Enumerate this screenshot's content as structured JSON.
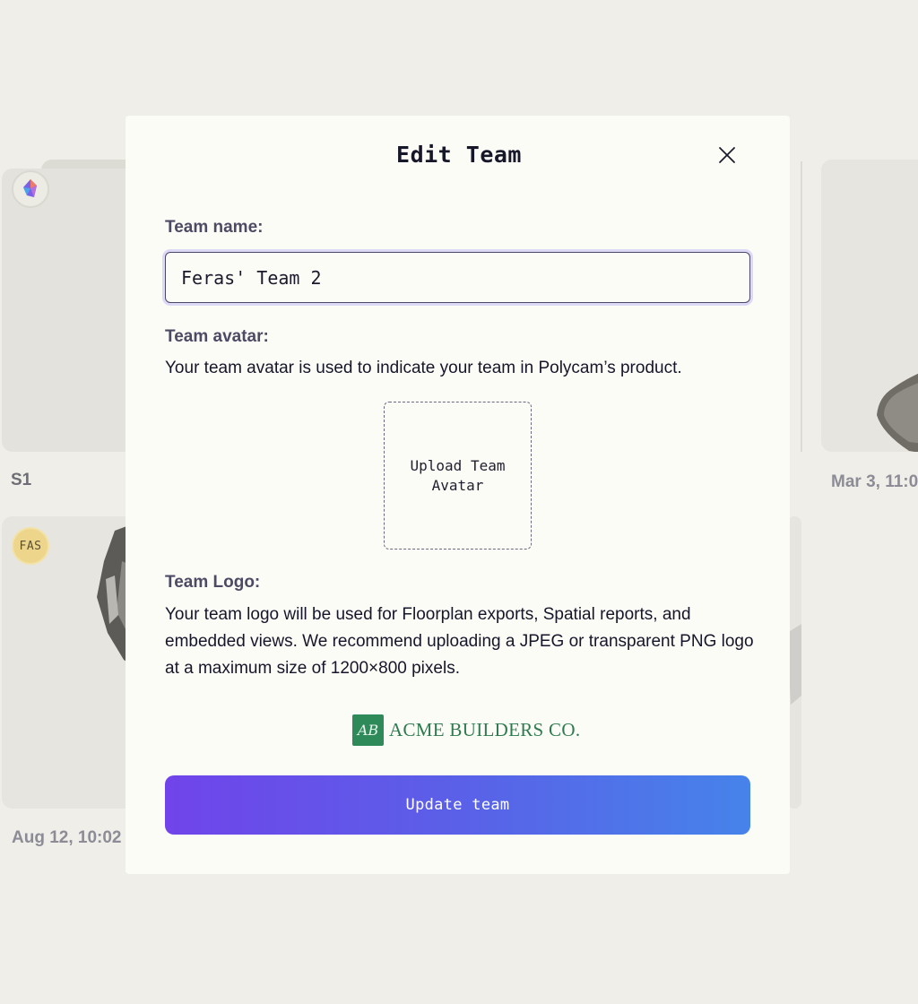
{
  "background": {
    "cards": [
      {
        "label": "S1",
        "avatar": "app-logo-icon"
      },
      {
        "label": "Mar 3, 11:0"
      },
      {
        "label": "Aug 12, 10:02",
        "avatar_initials": "FAS"
      }
    ]
  },
  "modal": {
    "title": "Edit Team",
    "close_icon": "close-icon",
    "team_name_label": "Team name:",
    "team_name_value": "Feras' Team 2",
    "team_avatar_label": "Team avatar:",
    "team_avatar_description": "Your team avatar is used to indicate your team in Polycam’s product.",
    "upload_avatar_label": "Upload Team Avatar",
    "team_logo_label": "Team Logo:",
    "team_logo_description": "Your team logo will be used for Floorplan exports, Spatial reports, and embedded views. We recommend uploading a JPEG or transparent PNG logo at a maximum size of 1200×800 pixels.",
    "logo": {
      "mark": "AB",
      "text": "ACME BUILDERS CO.",
      "color": "#2f8a5a"
    },
    "update_button_label": "Update team"
  },
  "colors": {
    "page_background": "#efeee8",
    "modal_background": "#fcfcf7",
    "button_gradient_start": "#7044ea",
    "button_gradient_end": "#4683ea",
    "label_color": "#4d4b64"
  }
}
